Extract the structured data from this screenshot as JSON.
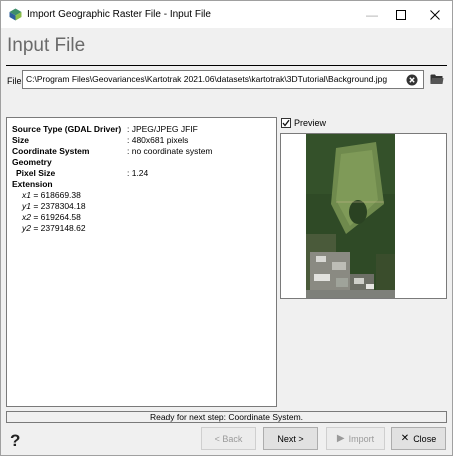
{
  "window": {
    "title": "Import Geographic Raster File - Input File",
    "app_icon": "kartotrak-app-icon"
  },
  "header": {
    "title": "Input File"
  },
  "file": {
    "label": "File",
    "value": "C:\\Program Files\\Geovariances\\Kartotrak 2021.06\\datasets\\kartotrak\\3DTutorial\\Background.jpg",
    "clear_icon": "clear-circle-x-icon",
    "browse_icon": "folder-open-icon"
  },
  "info": {
    "source_type_label": "Source Type (GDAL Driver)",
    "source_type_value": ": JPEG/JPEG JFIF",
    "size_label": "Size",
    "size_value": ": 480x681 pixels",
    "coord_system_label": "Coordinate System",
    "coord_system_value": ": no coordinate system",
    "geometry_label": "Geometry",
    "pixel_size_label": "Pixel Size",
    "pixel_size_value": ": 1.24",
    "extension_label": "Extension",
    "extension": [
      {
        "key": "x1",
        "value": "= 618669.38"
      },
      {
        "key": "y1",
        "value": "= 2378304.18"
      },
      {
        "key": "x2",
        "value": "= 619264.58"
      },
      {
        "key": "y2",
        "value": "= 2379148.62"
      }
    ]
  },
  "preview": {
    "label": "Preview",
    "checked": true
  },
  "status": {
    "text": "Ready for next step: Coordinate System."
  },
  "buttons": {
    "back": "< Back",
    "next": "Next >",
    "import": "Import",
    "close": "Close"
  },
  "colors": {
    "title_gray": "#6a6a6a",
    "disabled_text": "#9a9a9a"
  }
}
